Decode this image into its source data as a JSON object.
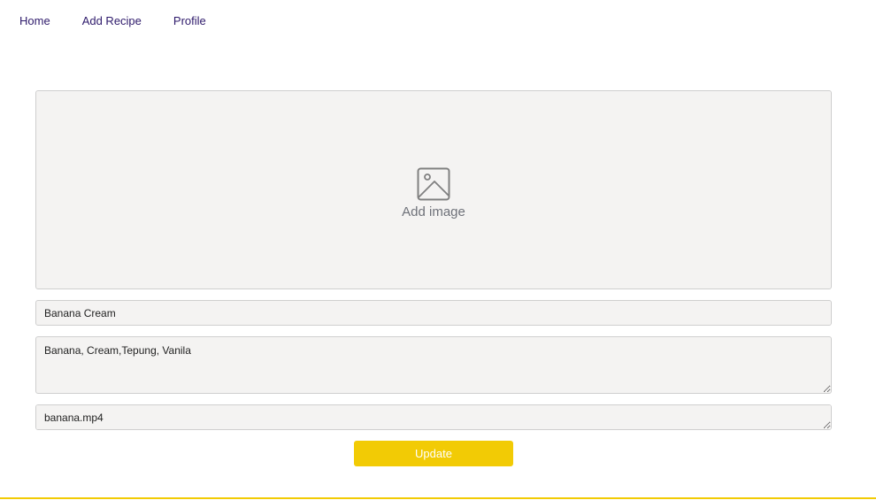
{
  "nav": {
    "items": [
      {
        "label": "Home"
      },
      {
        "label": "Add Recipe"
      },
      {
        "label": "Profile"
      }
    ]
  },
  "image_upload": {
    "icon": "image-icon",
    "label": "Add image"
  },
  "form": {
    "title_value": "Banana Cream",
    "ingredients_value": "Banana, Cream,Tepung, Vanila",
    "video_value": "banana.mp4",
    "submit_label": "Update"
  },
  "colors": {
    "accent": "#f2cb05",
    "nav_text": "#2e1a6b",
    "field_bg": "#f4f3f2"
  }
}
